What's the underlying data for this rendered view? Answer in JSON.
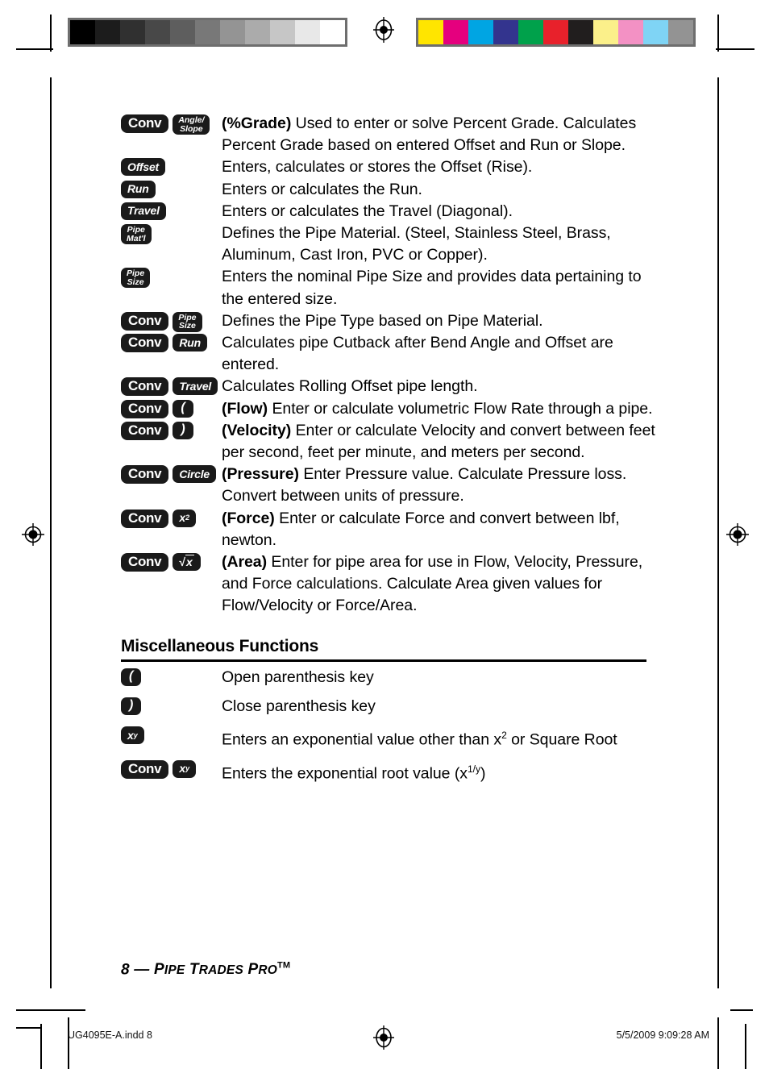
{
  "press_marks": {
    "gray_bar_name": "grayscale-calibration-bar",
    "color_bar_name": "color-calibration-bar",
    "gray_swatches": [
      "#000000",
      "#1c1c1c",
      "#303030",
      "#484848",
      "#5e5e5e",
      "#787878",
      "#949494",
      "#ababab",
      "#c6c6c6",
      "#e8e8e8",
      "#ffffff"
    ],
    "color_swatches": [
      "#ffe500",
      "#e5007e",
      "#00a5e3",
      "#33348e",
      "#00a14b",
      "#e8212b",
      "#211e1e",
      "#fbf08a",
      "#f391c4",
      "#7fd4f5",
      "#939393"
    ]
  },
  "entries": [
    {
      "keys": [
        {
          "type": "conv",
          "label": "Conv"
        },
        {
          "type": "stack",
          "line1": "Angle/",
          "line2": "Slope"
        }
      ],
      "lead": "(%Grade)",
      "text": " Used to enter or solve Percent Grade. Calculates Percent Grade based on entered Offset and Run or Slope."
    },
    {
      "keys": [
        {
          "type": "single",
          "label": "Offset"
        }
      ],
      "lead": "",
      "text": "Enters, calculates or stores the Offset (Rise)."
    },
    {
      "keys": [
        {
          "type": "single",
          "label": "Run"
        }
      ],
      "lead": "",
      "text": "Enters or calculates the Run."
    },
    {
      "keys": [
        {
          "type": "single",
          "label": "Travel"
        }
      ],
      "lead": "",
      "text": "Enters or calculates the Travel (Diagonal)."
    },
    {
      "keys": [
        {
          "type": "stack",
          "line1": "Pipe",
          "line2": "Mat'l"
        }
      ],
      "lead": "",
      "text": "Defines the Pipe Material. (Steel, Stainless Steel, Brass, Aluminum, Cast Iron, PVC or Copper)."
    },
    {
      "keys": [
        {
          "type": "stack",
          "line1": "Pipe",
          "line2": "Size"
        }
      ],
      "lead": "",
      "text": "Enters the nominal Pipe Size and provides data pertaining to the entered size."
    },
    {
      "keys": [
        {
          "type": "conv",
          "label": "Conv"
        },
        {
          "type": "stack",
          "line1": "Pipe",
          "line2": "Size"
        }
      ],
      "lead": "",
      "text": "Defines the Pipe Type based on Pipe Material."
    },
    {
      "keys": [
        {
          "type": "conv",
          "label": "Conv"
        },
        {
          "type": "single",
          "label": "Run"
        }
      ],
      "lead": "",
      "text": "Calculates pipe Cutback after Bend Angle and Offset are entered."
    },
    {
      "keys": [
        {
          "type": "conv",
          "label": "Conv"
        },
        {
          "type": "single",
          "label": "Travel"
        }
      ],
      "lead": "",
      "text": "Calculates Rolling Offset pipe length."
    },
    {
      "keys": [
        {
          "type": "conv",
          "label": "Conv"
        },
        {
          "type": "sym",
          "label": "("
        }
      ],
      "lead": "(Flow)",
      "text": " Enter or calculate volumetric Flow Rate through a pipe."
    },
    {
      "keys": [
        {
          "type": "conv",
          "label": "Conv"
        },
        {
          "type": "sym",
          "label": ")"
        }
      ],
      "lead": "(Velocity)",
      "text": "  Enter or calculate Velocity and convert between feet per second, feet per minute, and meters per second."
    },
    {
      "keys": [
        {
          "type": "conv",
          "label": "Conv"
        },
        {
          "type": "single",
          "label": "Circle"
        }
      ],
      "lead": "(Pressure)",
      "text": " Enter Pressure value. Calculate Pressure loss. Convert between units of pressure."
    },
    {
      "keys": [
        {
          "type": "conv",
          "label": "Conv"
        },
        {
          "type": "math",
          "label": "x",
          "sup": "2"
        }
      ],
      "lead": "(Force)",
      "text": " Enter or calculate Force and convert between lbf, newton."
    },
    {
      "keys": [
        {
          "type": "conv",
          "label": "Conv"
        },
        {
          "type": "radical",
          "label": "x"
        }
      ],
      "lead": "(Area)",
      "text": " Enter for pipe area for use in Flow, Velocity, Pressure, and Force calculations. Calculate Area given values for Flow/Velocity or Force/Area."
    }
  ],
  "misc_section": {
    "heading": "Miscellaneous Functions",
    "entries": [
      {
        "keys": [
          {
            "type": "sym",
            "label": "("
          }
        ],
        "text": "Open parenthesis key"
      },
      {
        "keys": [
          {
            "type": "sym",
            "label": ")"
          }
        ],
        "text": "Close parenthesis key"
      },
      {
        "keys": [
          {
            "type": "math",
            "label": "x",
            "sup": "y"
          }
        ],
        "text_pre": "Enters an exponential value other than x",
        "text_sup": "2",
        "text_post": " or Square Root"
      },
      {
        "keys": [
          {
            "type": "conv",
            "label": "Conv"
          },
          {
            "type": "math",
            "label": "x",
            "sup": "y"
          }
        ],
        "text_pre": "Enters the exponential root value (x",
        "text_sup": "1/y",
        "text_post": ")"
      }
    ]
  },
  "footer": {
    "page_number": "8",
    "dash": "—",
    "product_p1": "P",
    "product_rest1": "IPE",
    "product_p2": "T",
    "product_rest2": "RADES",
    "product_p3": "P",
    "product_rest3": "RO",
    "trademark": "TM"
  },
  "print_slug": {
    "filename": "UG4095E-A.indd   8",
    "timestamp": "5/5/2009   9:09:28 AM"
  }
}
